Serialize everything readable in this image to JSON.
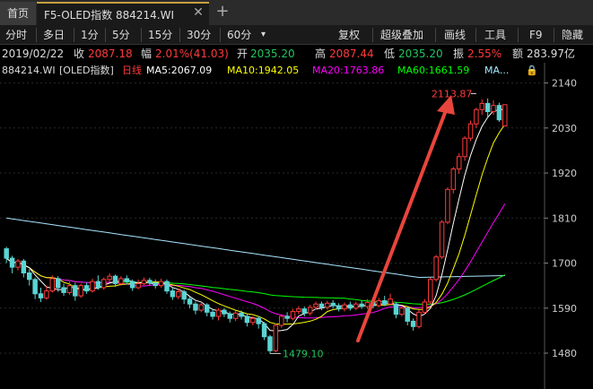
{
  "tabs": {
    "home": "首页",
    "active": "F5-OLED指数 884214.WI",
    "close": "✕",
    "add": "+"
  },
  "toolbar": {
    "left": [
      "分时",
      "多日",
      "1分",
      "5分",
      "15分",
      "30分",
      "60分"
    ],
    "dropdown": "▾",
    "right": [
      "复权",
      "超级叠加",
      "画线",
      "工具",
      "F9",
      "隐藏"
    ]
  },
  "quote": {
    "date": "2019/02/22",
    "close_label": "收",
    "close": "2087.18",
    "change_label": "幅",
    "change": "2.01%(41.03)",
    "open_label": "开",
    "open": "2035.20",
    "high_label": "高",
    "high": "2087.44",
    "low_label": "低",
    "low": "2035.20",
    "amp_label": "振",
    "amp": "2.55%",
    "amount_label": "额",
    "amount": "283.97亿"
  },
  "ma_legend": {
    "code": "884214.WI",
    "name": "[OLED指数]",
    "period": "日线",
    "ma5": "MA5:2067.09",
    "ma10": "MA10:1942.05",
    "ma20": "MA20:1763.86",
    "ma60": "MA60:1661.59",
    "more": "MA...",
    "lock_icon": "lock-icon"
  },
  "chart_data": {
    "type": "candlestick",
    "y_ticks": [
      2140,
      2030,
      1920,
      1810,
      1700,
      1590,
      1480
    ],
    "ylim": [
      1445,
      2150
    ],
    "annotations": {
      "high_label": "2113.87",
      "low_label": "1479.10"
    },
    "colors": {
      "up": "#ff3b3b",
      "down": "#5ad4d4",
      "ma5": "#ffffff",
      "ma10": "#ffff00",
      "ma20": "#ff00ff",
      "ma60": "#00ff00",
      "ma_long": "#a8e6ff",
      "arrow": "#e8453c"
    },
    "candles": [
      [
        1735,
        1712,
        1740,
        1700,
        1
      ],
      [
        1712,
        1690,
        1718,
        1675,
        1
      ],
      [
        1690,
        1705,
        1710,
        1682,
        0
      ],
      [
        1705,
        1676,
        1710,
        1665,
        1
      ],
      [
        1676,
        1660,
        1685,
        1645,
        1
      ],
      [
        1660,
        1625,
        1665,
        1612,
        1
      ],
      [
        1625,
        1615,
        1640,
        1605,
        1
      ],
      [
        1615,
        1632,
        1645,
        1610,
        0
      ],
      [
        1632,
        1662,
        1670,
        1628,
        0
      ],
      [
        1662,
        1640,
        1668,
        1630,
        1
      ],
      [
        1640,
        1628,
        1650,
        1620,
        1
      ],
      [
        1628,
        1645,
        1655,
        1622,
        0
      ],
      [
        1645,
        1620,
        1652,
        1608,
        1
      ],
      [
        1620,
        1645,
        1650,
        1615,
        0
      ],
      [
        1645,
        1632,
        1652,
        1625,
        1
      ],
      [
        1632,
        1655,
        1662,
        1628,
        0
      ],
      [
        1655,
        1640,
        1670,
        1635,
        1
      ],
      [
        1640,
        1660,
        1665,
        1635,
        0
      ],
      [
        1660,
        1668,
        1675,
        1652,
        0
      ],
      [
        1668,
        1650,
        1672,
        1642,
        1
      ],
      [
        1650,
        1662,
        1668,
        1645,
        0
      ],
      [
        1662,
        1655,
        1670,
        1648,
        1
      ],
      [
        1655,
        1640,
        1660,
        1632,
        1
      ],
      [
        1640,
        1650,
        1660,
        1636,
        0
      ],
      [
        1650,
        1658,
        1665,
        1645,
        0
      ],
      [
        1658,
        1652,
        1664,
        1645,
        1
      ],
      [
        1652,
        1645,
        1660,
        1638,
        1
      ],
      [
        1645,
        1655,
        1662,
        1640,
        0
      ],
      [
        1655,
        1632,
        1660,
        1625,
        1
      ],
      [
        1632,
        1618,
        1640,
        1610,
        1
      ],
      [
        1618,
        1630,
        1638,
        1612,
        0
      ],
      [
        1630,
        1612,
        1635,
        1600,
        1
      ],
      [
        1612,
        1600,
        1618,
        1590,
        1
      ],
      [
        1600,
        1585,
        1606,
        1575,
        1
      ],
      [
        1585,
        1598,
        1605,
        1580,
        0
      ],
      [
        1598,
        1580,
        1602,
        1570,
        1
      ],
      [
        1580,
        1570,
        1588,
        1562,
        1
      ],
      [
        1570,
        1585,
        1590,
        1560,
        0
      ],
      [
        1585,
        1576,
        1590,
        1568,
        1
      ],
      [
        1576,
        1565,
        1582,
        1555,
        1
      ],
      [
        1565,
        1578,
        1584,
        1558,
        0
      ],
      [
        1578,
        1570,
        1584,
        1562,
        1
      ],
      [
        1570,
        1555,
        1575,
        1545,
        1
      ],
      [
        1555,
        1565,
        1570,
        1548,
        0
      ],
      [
        1565,
        1552,
        1570,
        1540,
        1
      ],
      [
        1552,
        1520,
        1556,
        1512,
        1
      ],
      [
        1520,
        1486,
        1525,
        1479,
        1
      ],
      [
        1486,
        1548,
        1552,
        1482,
        0
      ],
      [
        1548,
        1570,
        1575,
        1542,
        0
      ],
      [
        1570,
        1565,
        1580,
        1555,
        1
      ],
      [
        1565,
        1582,
        1588,
        1560,
        0
      ],
      [
        1582,
        1588,
        1595,
        1575,
        0
      ],
      [
        1588,
        1578,
        1594,
        1570,
        1
      ],
      [
        1578,
        1592,
        1598,
        1572,
        0
      ],
      [
        1592,
        1600,
        1606,
        1586,
        0
      ],
      [
        1600,
        1592,
        1606,
        1585,
        1
      ],
      [
        1592,
        1602,
        1608,
        1586,
        0
      ],
      [
        1602,
        1596,
        1610,
        1590,
        1
      ],
      [
        1596,
        1588,
        1602,
        1582,
        1
      ],
      [
        1588,
        1598,
        1604,
        1582,
        0
      ],
      [
        1598,
        1590,
        1606,
        1584,
        1
      ],
      [
        1590,
        1600,
        1606,
        1585,
        0
      ],
      [
        1600,
        1594,
        1608,
        1588,
        1
      ],
      [
        1594,
        1604,
        1612,
        1588,
        0
      ],
      [
        1604,
        1596,
        1610,
        1590,
        1
      ],
      [
        1596,
        1608,
        1615,
        1592,
        0
      ],
      [
        1608,
        1600,
        1620,
        1595,
        1
      ],
      [
        1600,
        1612,
        1625,
        1598,
        0
      ],
      [
        1600,
        1575,
        1605,
        1565,
        1
      ],
      [
        1575,
        1590,
        1596,
        1570,
        0
      ],
      [
        1590,
        1558,
        1594,
        1548,
        1
      ],
      [
        1558,
        1545,
        1565,
        1535,
        1
      ],
      [
        1545,
        1580,
        1585,
        1540,
        0
      ],
      [
        1580,
        1605,
        1612,
        1575,
        0
      ],
      [
        1605,
        1660,
        1665,
        1600,
        0
      ],
      [
        1660,
        1715,
        1720,
        1655,
        0
      ],
      [
        1715,
        1800,
        1805,
        1710,
        0
      ],
      [
        1800,
        1880,
        1885,
        1795,
        0
      ],
      [
        1880,
        1930,
        1935,
        1870,
        0
      ],
      [
        1930,
        1960,
        1968,
        1918,
        0
      ],
      [
        1960,
        2005,
        2010,
        1950,
        0
      ],
      [
        2005,
        2040,
        2048,
        1998,
        0
      ],
      [
        2040,
        2075,
        2080,
        2030,
        0
      ],
      [
        2075,
        2090,
        2100,
        2062,
        0
      ],
      [
        2090,
        2070,
        2102,
        2058,
        1
      ],
      [
        2070,
        2085,
        2098,
        2062,
        0
      ],
      [
        2085,
        2050,
        2092,
        2045,
        1
      ],
      [
        2035,
        2087,
        2087,
        2035,
        0
      ]
    ]
  }
}
